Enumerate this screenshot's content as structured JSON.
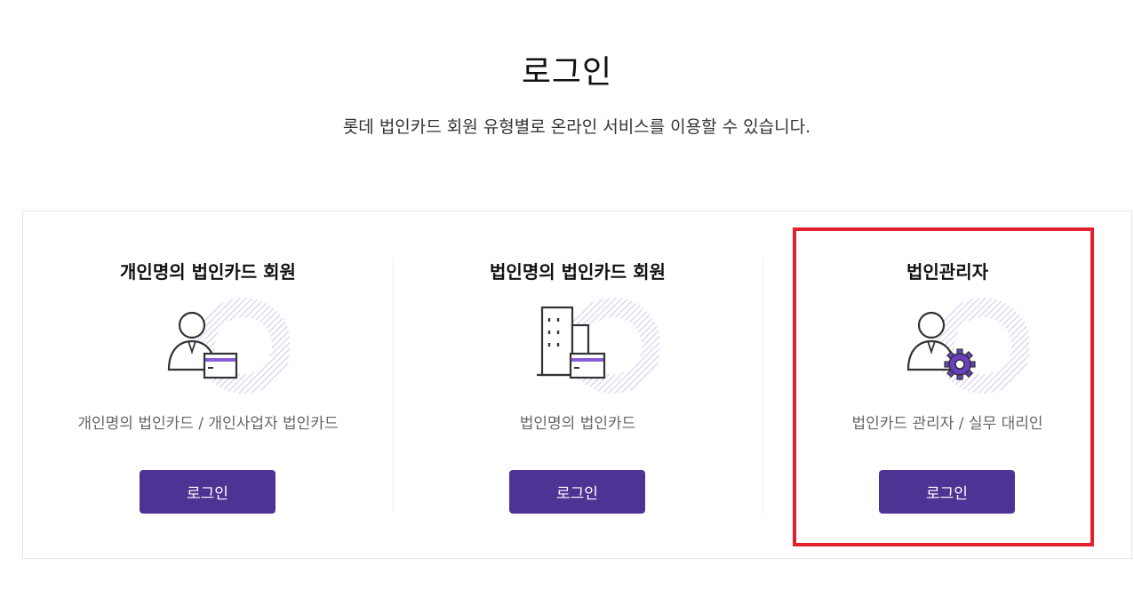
{
  "header": {
    "title": "로그인",
    "subtitle": "롯데 법인카드 회원 유형별로 온라인 서비스를 이용할 수 있습니다."
  },
  "cards": [
    {
      "title": "개인명의 법인카드 회원",
      "description": "개인명의 법인카드 / 개인사업자 법인카드",
      "icon": "person-card-icon",
      "button_label": "로그인"
    },
    {
      "title": "법인명의 법인카드 회원",
      "description": "법인명의 법인카드",
      "icon": "building-card-icon",
      "button_label": "로그인"
    },
    {
      "title": "법인관리자",
      "description": "법인카드 관리자 / 실무 대리인",
      "icon": "person-gear-icon",
      "button_label": "로그인"
    }
  ],
  "colors": {
    "accent": "#4d3494",
    "accent_light": "#8a5bd8",
    "highlight": "#e3202b"
  }
}
